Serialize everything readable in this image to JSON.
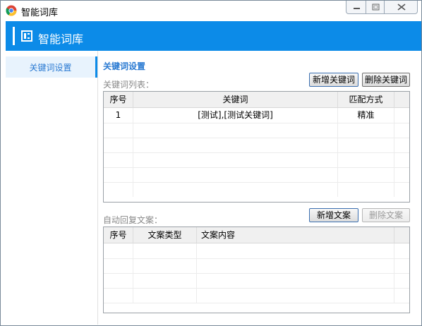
{
  "window": {
    "title": "智能词库",
    "controls": {
      "minimize": "minimize-icon",
      "maximize": "maximize-icon",
      "close": "close-icon"
    }
  },
  "header": {
    "title": "智能词库",
    "icon": "panel-icon"
  },
  "sidebar": {
    "items": [
      {
        "label": "关键词设置",
        "active": true
      }
    ]
  },
  "keywords": {
    "section_title": "关键词设置",
    "list_label": "关键词列表：",
    "add_button": "新增关键词",
    "delete_button": "删除关键词",
    "columns": [
      "序号",
      "关键词",
      "匹配方式"
    ],
    "rows": [
      {
        "index": "1",
        "keyword": "[测试],[测试关键词]",
        "match": "精准"
      }
    ]
  },
  "replies": {
    "label": "自动回复文案：",
    "add_button": "新增文案",
    "delete_button": "删除文案",
    "delete_enabled": false,
    "columns": [
      "序号",
      "文案类型",
      "文案内容"
    ],
    "rows": []
  },
  "colors": {
    "accent": "#0c8be8",
    "link": "#2a7ad2",
    "sidebar_active_bg": "#e8f3fd"
  }
}
